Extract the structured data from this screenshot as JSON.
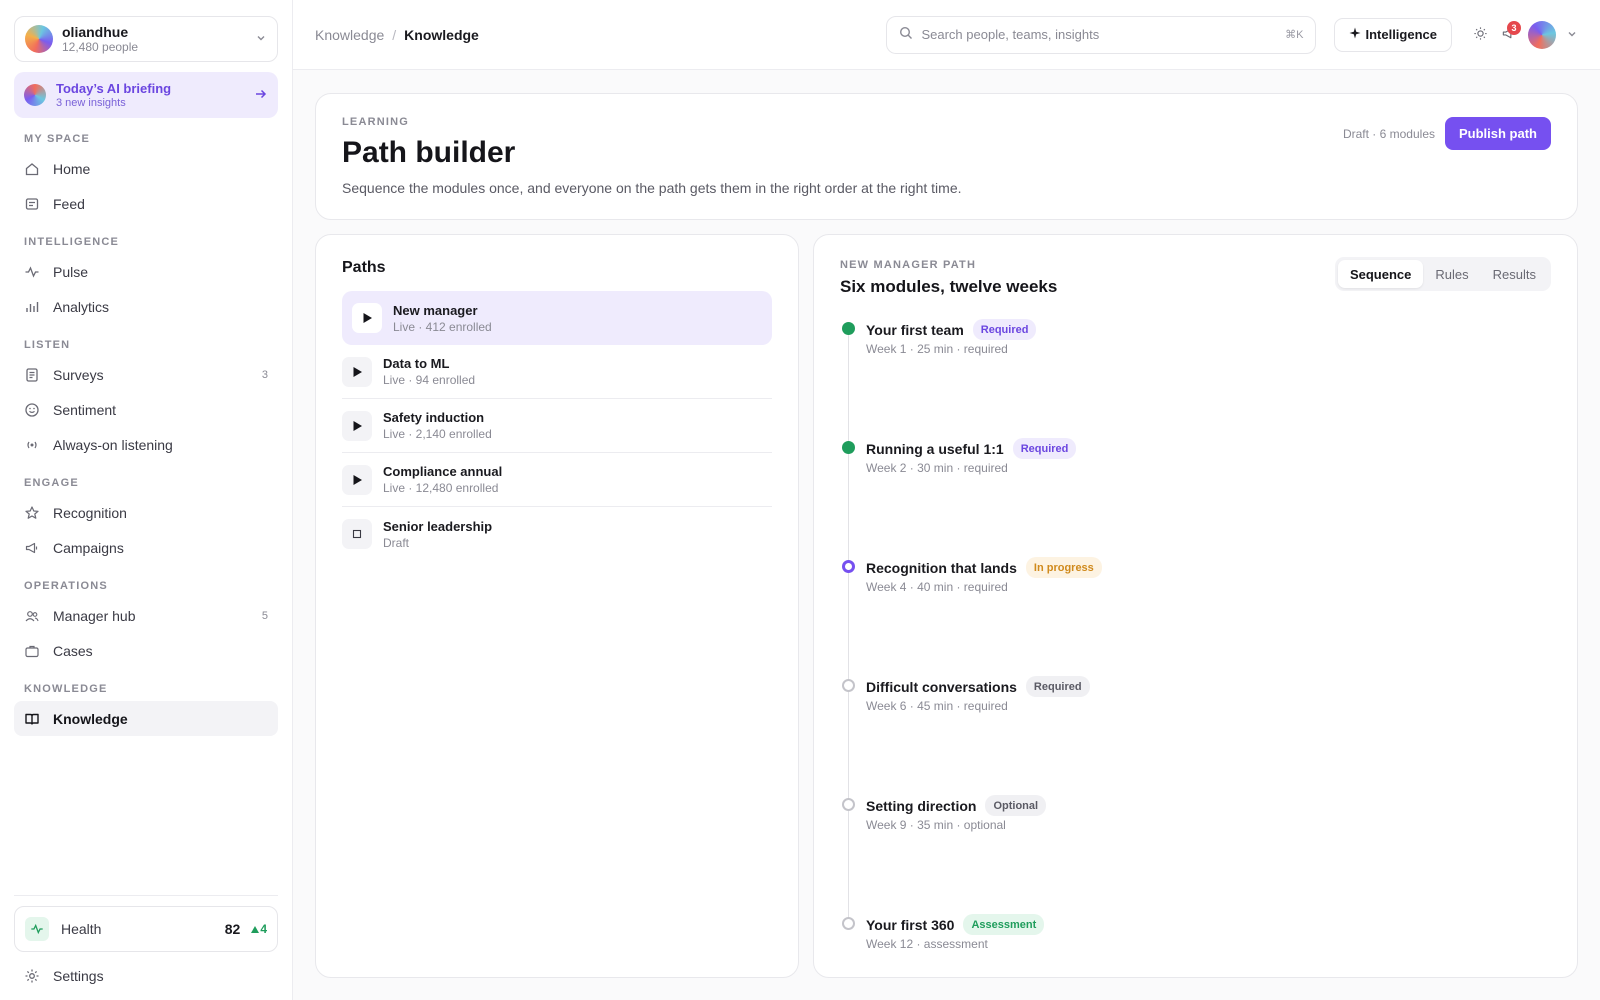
{
  "org": {
    "name": "oliandhue",
    "subtitle": "12,480 people"
  },
  "briefing": {
    "title": "Today’s AI briefing",
    "subtitle": "3 new insights"
  },
  "nav": {
    "sections": [
      {
        "label": "MY SPACE",
        "items": [
          {
            "label": "Home",
            "icon": "home-icon"
          },
          {
            "label": "Feed",
            "icon": "feed-icon"
          }
        ]
      },
      {
        "label": "INTELLIGENCE",
        "items": [
          {
            "label": "Pulse",
            "icon": "pulse-icon"
          },
          {
            "label": "Analytics",
            "icon": "bar-chart-icon"
          }
        ]
      },
      {
        "label": "LISTEN",
        "items": [
          {
            "label": "Surveys",
            "icon": "survey-icon",
            "count": "3"
          },
          {
            "label": "Sentiment",
            "icon": "smile-icon"
          },
          {
            "label": "Always-on listening",
            "icon": "broadcast-icon"
          }
        ]
      },
      {
        "label": "ENGAGE",
        "items": [
          {
            "label": "Recognition",
            "icon": "star-icon"
          },
          {
            "label": "Campaigns",
            "icon": "megaphone-icon"
          }
        ]
      },
      {
        "label": "OPERATIONS",
        "items": [
          {
            "label": "Manager hub",
            "icon": "users-icon",
            "count": "5"
          },
          {
            "label": "Cases",
            "icon": "briefcase-icon"
          }
        ]
      },
      {
        "label": "KNOWLEDGE",
        "items": [
          {
            "label": "Knowledge",
            "icon": "book-icon",
            "active": true
          }
        ]
      }
    ]
  },
  "health": {
    "label": "Health",
    "score": "82",
    "delta": "4"
  },
  "settings": {
    "label": "Settings"
  },
  "topbar": {
    "breadcrumb": [
      "Knowledge",
      "Knowledge"
    ],
    "search_placeholder": "Search people, teams, insights",
    "search_shortcut": "⌘K",
    "intelligence_label": "Intelligence",
    "notification_count": "3"
  },
  "hero": {
    "eyebrow": "LEARNING",
    "title": "Path builder",
    "description": "Sequence the modules once, and everyone on the path gets them in the right order at the right time.",
    "meta": "Draft · 6 modules",
    "publish_label": "Publish path"
  },
  "paths": {
    "title": "Paths",
    "items": [
      {
        "name": "New manager",
        "meta": "Live · 412 enrolled",
        "status": "live",
        "selected": true
      },
      {
        "name": "Data to ML",
        "meta": "Live · 94 enrolled",
        "status": "live"
      },
      {
        "name": "Safety induction",
        "meta": "Live · 2,140 enrolled",
        "status": "live"
      },
      {
        "name": "Compliance annual",
        "meta": "Live · 12,480 enrolled",
        "status": "live"
      },
      {
        "name": "Senior leadership",
        "meta": "Draft",
        "status": "draft"
      }
    ]
  },
  "detail": {
    "eyebrow": "NEW MANAGER PATH",
    "title": "Six modules, twelve weeks",
    "tabs": [
      {
        "label": "Sequence",
        "active": true
      },
      {
        "label": "Rules"
      },
      {
        "label": "Results"
      }
    ],
    "steps": [
      {
        "name": "Your first team",
        "tag": "Required",
        "tag_style": "req-purple",
        "meta": "Week 1 · 25 min · required",
        "state": "done"
      },
      {
        "name": "Running a useful 1:1",
        "tag": "Required",
        "tag_style": "req-purple",
        "meta": "Week 2 · 30 min · required",
        "state": "done"
      },
      {
        "name": "Recognition that lands",
        "tag": "In progress",
        "tag_style": "progress",
        "meta": "Week 4 · 40 min · required",
        "state": "progress"
      },
      {
        "name": "Difficult conversations",
        "tag": "Required",
        "tag_style": "gray",
        "meta": "Week 6 · 45 min · required",
        "state": "todo"
      },
      {
        "name": "Setting direction",
        "tag": "Optional",
        "tag_style": "gray",
        "meta": "Week 9 · 35 min · optional",
        "state": "todo"
      },
      {
        "name": "Your first 360",
        "tag": "Assessment",
        "tag_style": "green",
        "meta": "Week 12 · assessment",
        "state": "todo"
      }
    ]
  },
  "colors": {
    "accent": "#7650f0",
    "success": "#1f9d5c",
    "warning": "#d08a1c",
    "danger": "#e5484d"
  }
}
